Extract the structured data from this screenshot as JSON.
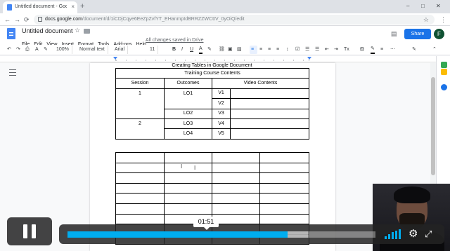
{
  "browser": {
    "tab_title": "Untitled document - Google Do",
    "tab_close": "×",
    "new_tab": "+",
    "url_prefix": "docs.google.com",
    "url_path": "/document/d/1iCDjCqye6EeZpZvfYT_EHanmpIdBRRZZWCttV_0yOiQ/edit",
    "back": "←",
    "forward": "→",
    "reload": "⟳",
    "bookmark": "☆",
    "menu": "⋮",
    "minimize": "–",
    "maximize": "□",
    "close": "✕"
  },
  "docs": {
    "title": "Untitled document",
    "star": "☆",
    "menus": [
      "File",
      "Edit",
      "View",
      "Insert",
      "Format",
      "Tools",
      "Add-ons",
      "Help"
    ],
    "save_status": "All changes saved in Drive",
    "share_label": "Share",
    "avatar_initial": "F",
    "comment_icon": "▤",
    "lock_icon": "🔒"
  },
  "toolbar": {
    "undo": "↶",
    "redo": "↷",
    "print": "⎙",
    "spell": "A",
    "paint": "✎",
    "zoom": "100%",
    "style": "Normal text",
    "font": "Arial",
    "font_size": "11",
    "bold": "B",
    "italic": "I",
    "underline": "U",
    "text_color": "A",
    "highlight": "✎",
    "link": "⛓",
    "comment": "▣",
    "image": "▨",
    "align_left": "≡",
    "align_center": "≡",
    "align_right": "≡",
    "justify": "≡",
    "line_spacing": "↕",
    "checklist": "☑",
    "bullets": "☰",
    "numbered": "☰",
    "indent_less": "⇤",
    "indent_more": "⇥",
    "clear": "Tx",
    "editing_mode": "✎",
    "collapse": "⌃"
  },
  "document": {
    "heading": "Creating Tables in Google Document",
    "table1": {
      "title": "Training Course Contents",
      "headers": [
        "Session",
        "Outcomes",
        "Video Contents"
      ],
      "sessions": [
        "1",
        "2"
      ],
      "outcomes": [
        "LO1",
        "LO2",
        "LO3",
        "LO4"
      ],
      "videos": [
        "V1",
        "V2",
        "V3",
        "V4",
        "V5"
      ]
    },
    "cursor": "I",
    "ibeam": "I"
  },
  "video": {
    "current_time": "01:51",
    "progress_fraction": 0.714,
    "loaded_fraction": 0.78,
    "settings_icon": "⚙",
    "fullscreen_icon": "⤢",
    "accent_color": "#00adef"
  },
  "colors": {
    "share_blue": "#1a73e8",
    "docs_blue": "#4285f4"
  }
}
